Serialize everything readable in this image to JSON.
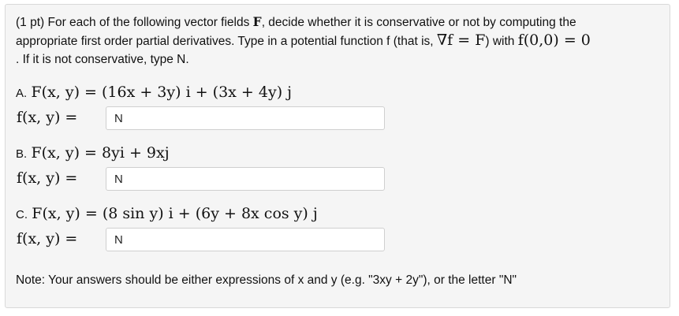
{
  "intro": {
    "line1_prefix": "(1 pt) For each of the following vector fields ",
    "field_symbol": "F",
    "line1_suffix": ", decide whether it is conservative or not by computing the",
    "line2_prefix": "appropriate first order partial derivatives. Type in a potential function f (that is, ",
    "potential_def": "∇f = F",
    "line2_mid": ") with ",
    "initial_condition": "f(0,0) = 0",
    "line3": ". If it is not conservative, type N."
  },
  "parts": [
    {
      "label": "A.",
      "field": "F(x, y) = (16x + 3y) i + (3x + 4y) j",
      "answer_label": "f(x, y) =",
      "answer": "N"
    },
    {
      "label": "B.",
      "field": "F(x, y) = 8yi + 9xj",
      "answer_label": "f(x, y) =",
      "answer": "N"
    },
    {
      "label": "C.",
      "field": "F(x, y) = (8 sin y) i + (6y + 8x cos y) j",
      "answer_label": "f(x, y) =",
      "answer": "N"
    }
  ],
  "note": "Note: Your answers should be either expressions of x and y (e.g. \"3xy + 2y\"), or the letter \"N\""
}
